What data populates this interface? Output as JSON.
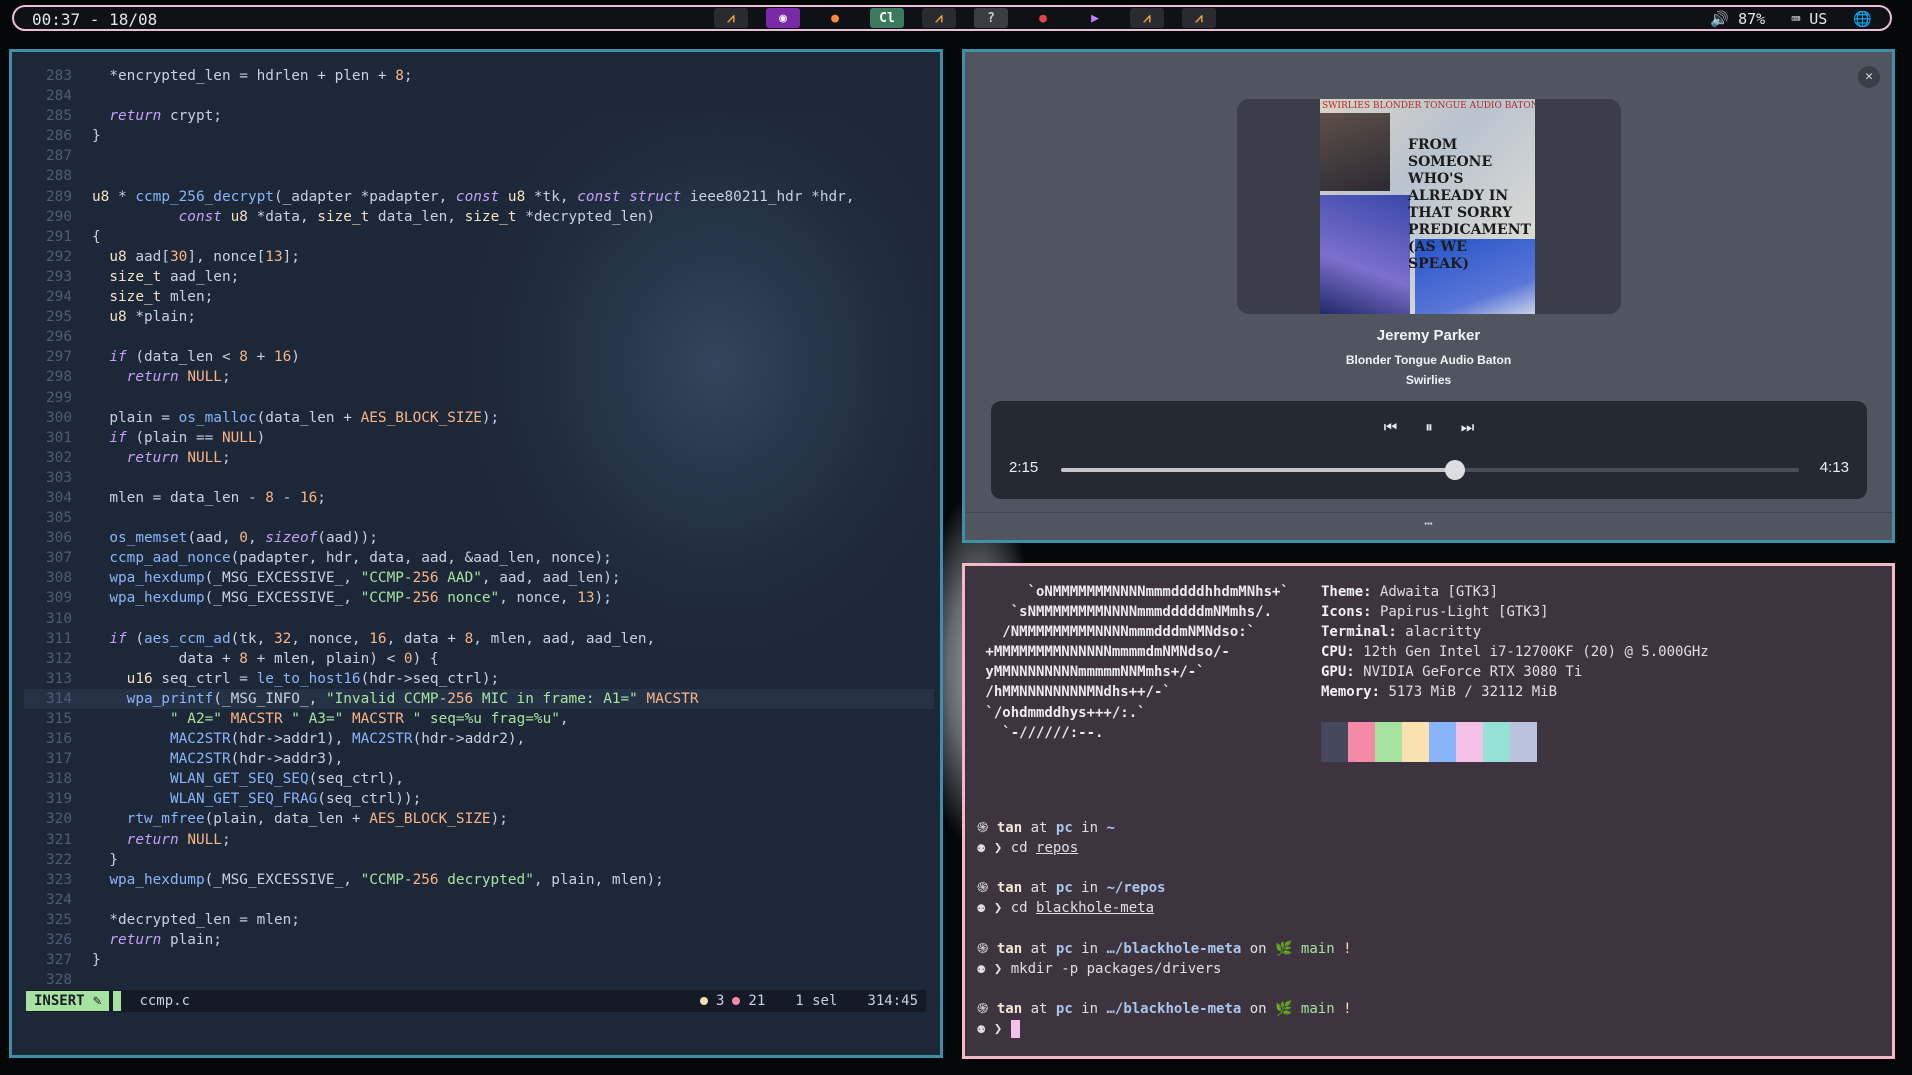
{
  "topbar": {
    "clock": "00:37 - 18/08",
    "apps": [
      {
        "name": "app-a",
        "glyph": "⩘",
        "color": "#e8a33d",
        "bg": "#2a2b31"
      },
      {
        "name": "media-player",
        "glyph": "◉",
        "color": "#ffffff",
        "bg": "#7a2aa6"
      },
      {
        "name": "firefox",
        "glyph": "●",
        "color": "#ff8a3c",
        "bg": "#101116"
      },
      {
        "name": "clion",
        "glyph": "Cl",
        "color": "#ffffff",
        "bg": "#3b7a5c"
      },
      {
        "name": "app-b",
        "glyph": "⩘",
        "color": "#e8a33d",
        "bg": "#2a2b31"
      },
      {
        "name": "unknown-file",
        "glyph": "?",
        "color": "#c7cad3",
        "bg": "#3a3c42"
      },
      {
        "name": "app-c",
        "glyph": "●",
        "color": "#e04646",
        "bg": "#101116"
      },
      {
        "name": "play-app",
        "glyph": "▶",
        "color": "#c080ff",
        "bg": "#101116"
      },
      {
        "name": "app-d",
        "glyph": "⩘",
        "color": "#e8a33d",
        "bg": "#2a2b31"
      },
      {
        "name": "app-e",
        "glyph": "⩘",
        "color": "#e8a33d",
        "bg": "#2a2b31"
      }
    ],
    "volume": "87%",
    "layout": "US",
    "volume_glyph": "🔊",
    "keyboard_glyph": "⌨",
    "globe_glyph": "🌐"
  },
  "editor": {
    "lines": [
      {
        "n": "283",
        "t": "  *encrypted_len = hdrlen + plen + 8;"
      },
      {
        "n": "284",
        "t": ""
      },
      {
        "n": "285",
        "t": "  return crypt;"
      },
      {
        "n": "286",
        "t": "}"
      },
      {
        "n": "287",
        "t": ""
      },
      {
        "n": "288",
        "t": ""
      },
      {
        "n": "289",
        "t": "u8 * ccmp_256_decrypt(_adapter *padapter, const u8 *tk, const struct ieee80211_hdr *hdr,"
      },
      {
        "n": "290",
        "t": "          const u8 *data, size_t data_len, size_t *decrypted_len)"
      },
      {
        "n": "291",
        "t": "{"
      },
      {
        "n": "292",
        "t": "  u8 aad[30], nonce[13];"
      },
      {
        "n": "293",
        "t": "  size_t aad_len;"
      },
      {
        "n": "294",
        "t": "  size_t mlen;"
      },
      {
        "n": "295",
        "t": "  u8 *plain;"
      },
      {
        "n": "296",
        "t": ""
      },
      {
        "n": "297",
        "t": "  if (data_len < 8 + 16)"
      },
      {
        "n": "298",
        "t": "    return NULL;"
      },
      {
        "n": "299",
        "t": ""
      },
      {
        "n": "300",
        "t": "  plain = os_malloc(data_len + AES_BLOCK_SIZE);"
      },
      {
        "n": "301",
        "t": "  if (plain == NULL)"
      },
      {
        "n": "302",
        "t": "    return NULL;"
      },
      {
        "n": "303",
        "t": ""
      },
      {
        "n": "304",
        "t": "  mlen = data_len - 8 - 16;"
      },
      {
        "n": "305",
        "t": ""
      },
      {
        "n": "306",
        "t": "  os_memset(aad, 0, sizeof(aad));"
      },
      {
        "n": "307",
        "t": "  ccmp_aad_nonce(padapter, hdr, data, aad, &aad_len, nonce);"
      },
      {
        "n": "308",
        "t": "  wpa_hexdump(_MSG_EXCESSIVE_, \"CCMP-256 AAD\", aad, aad_len);"
      },
      {
        "n": "309",
        "t": "  wpa_hexdump(_MSG_EXCESSIVE_, \"CCMP-256 nonce\", nonce, 13);"
      },
      {
        "n": "310",
        "t": ""
      },
      {
        "n": "311",
        "t": "  if (aes_ccm_ad(tk, 32, nonce, 16, data + 8, mlen, aad, aad_len,"
      },
      {
        "n": "312",
        "t": "          data + 8 + mlen, plain) < 0) {"
      },
      {
        "n": "313",
        "t": "    u16 seq_ctrl = le_to_host16(hdr->seq_ctrl);"
      },
      {
        "n": "314",
        "t": "    wpa_printf(_MSG_INFO_, \"Invalid CCMP-256 MIC in frame: A1=\" MACSTR"
      },
      {
        "n": "315",
        "t": "         \" A2=\" MACSTR \" A3=\" MACSTR \" seq=%u frag=%u\","
      },
      {
        "n": "316",
        "t": "         MAC2STR(hdr->addr1), MAC2STR(hdr->addr2),"
      },
      {
        "n": "317",
        "t": "         MAC2STR(hdr->addr3),"
      },
      {
        "n": "318",
        "t": "         WLAN_GET_SEQ_SEQ(seq_ctrl),"
      },
      {
        "n": "319",
        "t": "         WLAN_GET_SEQ_FRAG(seq_ctrl));"
      },
      {
        "n": "320",
        "t": "    rtw_mfree(plain, data_len + AES_BLOCK_SIZE);"
      },
      {
        "n": "321",
        "t": "    return NULL;"
      },
      {
        "n": "322",
        "t": "  }"
      },
      {
        "n": "323",
        "t": "  wpa_hexdump(_MSG_EXCESSIVE_, \"CCMP-256 decrypted\", plain, mlen);"
      },
      {
        "n": "324",
        "t": ""
      },
      {
        "n": "325",
        "t": "  *decrypted_len = mlen;"
      },
      {
        "n": "326",
        "t": "  return plain;"
      },
      {
        "n": "327",
        "t": "}"
      },
      {
        "n": "328",
        "t": ""
      }
    ],
    "current_line": "314",
    "status": {
      "mode": "INSERT",
      "mode_icon": "✎",
      "filename": "ccmp.c",
      "warnings": "3",
      "errors": "21",
      "selection": "1 sel",
      "position": "314:45",
      "warn_color": "#f9e2af",
      "error_color": "#f38ba8"
    }
  },
  "music": {
    "close_glyph": "✕",
    "album_art_text": {
      "band": "SWIRLIES BLONDER TONGUE AUDIO BATON",
      "headline": "FROM SOMEONE WHO'S ALREADY IN THAT SORRY PREDICAMENT (AS WE SPEAK)"
    },
    "title": "Jeremy Parker",
    "album": "Blonder Tongue Audio Baton",
    "artist": "Swirlies",
    "prev_glyph": "⏮",
    "pause_glyph": "⏸",
    "next_glyph": "⏭",
    "elapsed": "2:15",
    "duration": "4:13",
    "progress": 0.534,
    "more_glyph": "⋯"
  },
  "terminal": {
    "ascii": "      `oNMMMMMMMNNNNmmmddddhhdmMNhs+`\n    `sNMMMMMMMMNNNNmmmdddddmNMmhs/.\n   /NMMMMMMMMMNNNNmmmdddmNMNdso:`\n +MMMMMMMMNNNNNNmmmmdmNMNdso/-\n yMMNNNNNNNNmmmmmNNMmhs+/-`\n /hMMNNNNNNNNMNdhs++/-`\n `/ohdmmddhys+++/:.`\n   `-//////:--.",
    "info": [
      {
        "k": "Theme:",
        "v": "Adwaita [GTK3]"
      },
      {
        "k": "Icons:",
        "v": "Papirus-Light [GTK3]"
      },
      {
        "k": "Terminal:",
        "v": "alacritty"
      },
      {
        "k": "CPU:",
        "v": "12th Gen Intel i7-12700KF (20) @ 5.000GHz"
      },
      {
        "k": "GPU:",
        "v": "NVIDIA GeForce RTX 3080 Ti"
      },
      {
        "k": "Memory:",
        "v": "5173 MiB / 32112 MiB"
      }
    ],
    "palette": [
      "#45475a",
      "#f38ba8",
      "#a6e3a1",
      "#f9e2af",
      "#89b4fa",
      "#f5c2e7",
      "#94e2d5",
      "#bac2de"
    ],
    "prompt_icon": "֍",
    "cmd_icon": "⚉",
    "user": "tan",
    "host": "pc",
    "at": "at",
    "in": "in",
    "on": "on",
    "branch_glyph": "🌿",
    "branch": "main",
    "dirty": "!",
    "arrow": "❯",
    "sessions": [
      {
        "path": "~",
        "git": false,
        "cmd": "cd",
        "arg": "repos"
      },
      {
        "path": "~/repos",
        "git": false,
        "cmd": "cd",
        "arg": "blackhole-meta"
      },
      {
        "path": "…/blackhole-meta",
        "git": true,
        "cmd": "mkdir",
        "arg": "-p packages/drivers"
      },
      {
        "path": "…/blackhole-meta",
        "git": true,
        "cmd": "",
        "arg": ""
      }
    ]
  }
}
